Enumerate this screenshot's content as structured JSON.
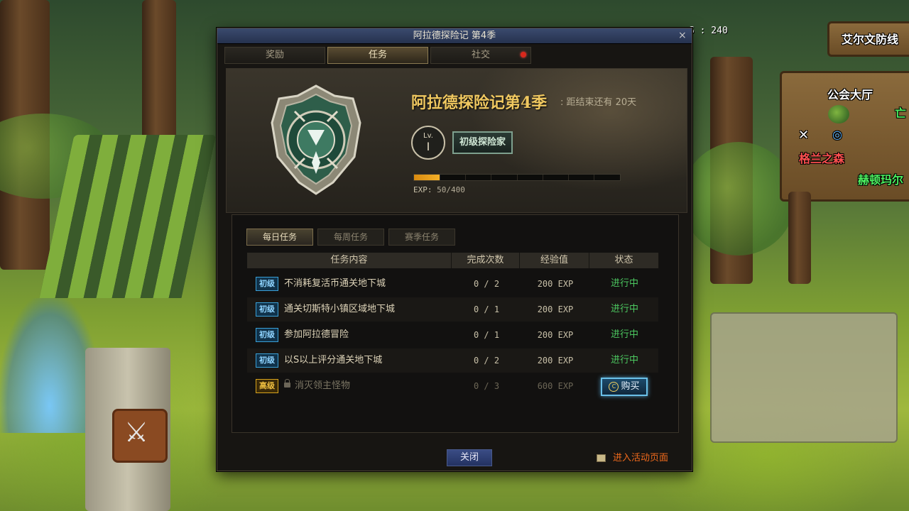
{
  "hud": {
    "fps": "S : 240"
  },
  "map": {
    "title": "艾尔文防线",
    "guild_hall": "公会大厅",
    "partial_right": "亡",
    "location_1": "格兰之森",
    "location_2": "赫顿玛尔",
    "colors": {
      "title": "#ffffff",
      "guild": "#ffffff",
      "loc1": "#ff5050",
      "loc2": "#4cf060",
      "partial": "#4cf060"
    }
  },
  "dialog": {
    "title": "阿拉德探险记 第4季",
    "close_glyph": "×",
    "tabs": [
      {
        "label": "奖励",
        "active": false,
        "badge": false
      },
      {
        "label": "任务",
        "active": true,
        "badge": false
      },
      {
        "label": "社交",
        "active": false,
        "badge": true
      }
    ],
    "season": {
      "name": "阿拉德探险记第4季",
      "countdown": ": 距结束还有 20天",
      "level_label": "Lv.",
      "level": "I",
      "rank": "初级探险家",
      "exp_label": "EXP:",
      "exp_current": 50,
      "exp_max": 400,
      "exp_text": "50/400",
      "exp_progress": 0.125,
      "emblem": "season-emblem-icon"
    },
    "sub_tabs": [
      {
        "label": "每日任务",
        "active": true
      },
      {
        "label": "每周任务",
        "active": false
      },
      {
        "label": "赛季任务",
        "active": false
      }
    ],
    "table": {
      "headers": [
        "任务内容",
        "完成次数",
        "经验值",
        "状态"
      ],
      "rows": [
        {
          "grade": "初级",
          "name": "不消耗复活币通关地下城",
          "count": "0 / 2",
          "exp": "200 EXP",
          "status": "进行中",
          "locked": false
        },
        {
          "grade": "初级",
          "name": "通关切斯特小镇区域地下城",
          "count": "0 / 1",
          "exp": "200 EXP",
          "status": "进行中",
          "locked": false
        },
        {
          "grade": "初级",
          "name": "参加阿拉德冒险",
          "count": "0 / 1",
          "exp": "200 EXP",
          "status": "进行中",
          "locked": false
        },
        {
          "grade": "初级",
          "name": "以S以上评分通关地下城",
          "count": "0 / 2",
          "exp": "200 EXP",
          "status": "进行中",
          "locked": false
        },
        {
          "grade": "高级",
          "name": "消灭领主怪物",
          "count": "0 / 3",
          "exp": "600 EXP",
          "status": "",
          "locked": true,
          "buy_label": "购买",
          "buy_glyph": "C"
        }
      ]
    },
    "close_label": "关闭",
    "goto_label": "进入活动页面",
    "colors": {
      "title_gold": "#f0c860",
      "status_green": "#4cc860",
      "link_orange": "#f06a1c",
      "exp_fill": "#f4b028",
      "grade_basic": "#3aa0d8",
      "grade_high": "#d8a41c"
    }
  }
}
